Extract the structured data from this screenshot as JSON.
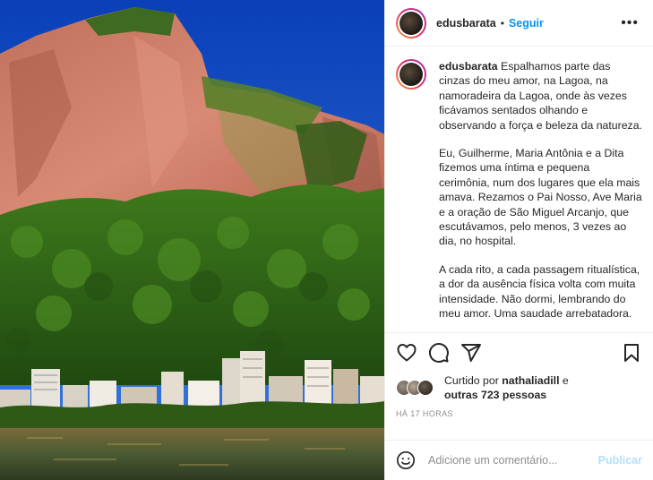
{
  "post": {
    "username": "edusbarata",
    "separator": "•",
    "follow_label": "Seguir",
    "more_glyph": "•••"
  },
  "caption": {
    "username": "edusbarata",
    "paragraphs": [
      "Espalhamos parte das cinzas do meu amor, na Lagoa, na namoradeira da Lagoa, onde às vezes ficávamos sentados olhando e observando a força e beleza da natureza.",
      "Eu, Guilherme, Maria Antônia e a Dita fizemos uma íntima e pequena cerimônia, num dos lugares que ela mais amava. Rezamos o Pai Nosso, Ave Maria e a oração de São Miguel Arcanjo, que escutávamos, pelo menos, 3 vezes ao dia, no hospital.",
      "A cada rito, a cada passagem ritualística, a dor da ausência física volta com muita intensidade. Não dormi, lembrando do meu amor. Uma saudade arrebatadora."
    ]
  },
  "actions": {
    "icons": [
      "heart-icon",
      "comment-icon",
      "share-icon",
      "bookmark-icon"
    ]
  },
  "likes": {
    "prefix": "Curtido por",
    "user": "nathaliadill",
    "connector": "e",
    "others": "outras 723 pessoas"
  },
  "timestamp": "HÁ 17 HORAS",
  "comment": {
    "placeholder": "Adicione um comentário...",
    "publish_label": "Publicar",
    "emoji_icon": "smiley-icon"
  },
  "colors": {
    "link_blue": "#0095f6",
    "publish_disabled": "#b2dffc",
    "muted_text": "#8e8e8e",
    "border": "#efefef"
  }
}
